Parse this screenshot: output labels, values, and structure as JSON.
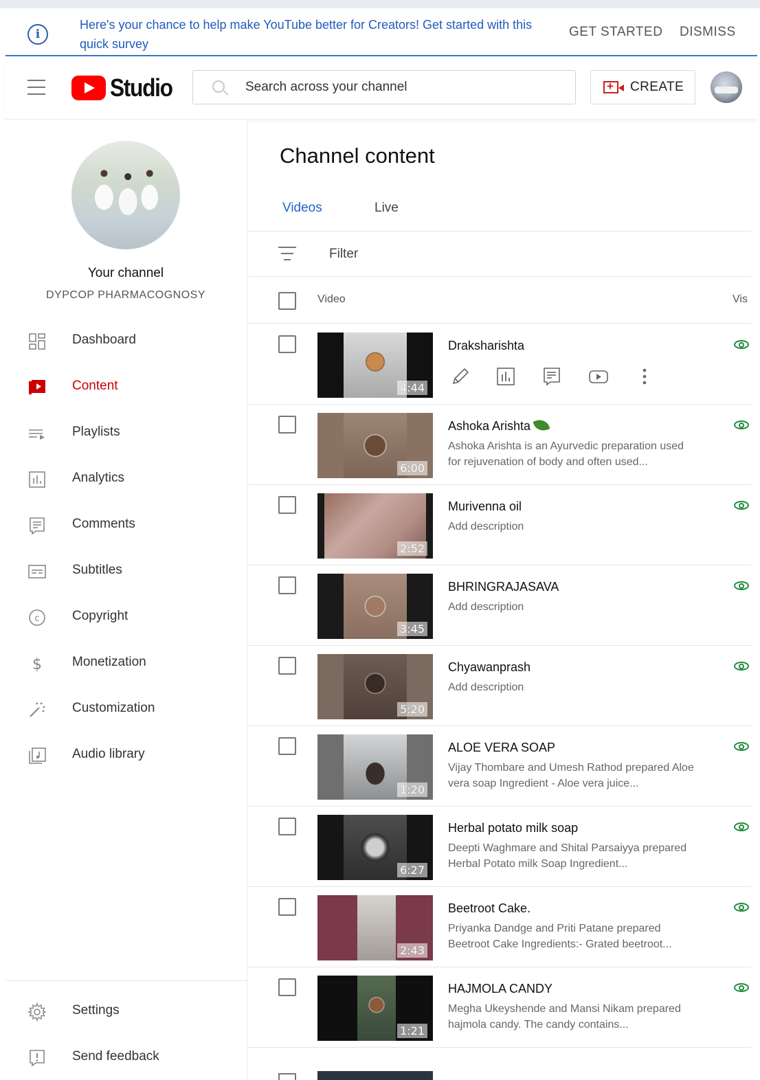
{
  "banner": {
    "message": "Here's your chance to help make YouTube better for Creators! Get started with this quick survey",
    "get_started": "GET STARTED",
    "dismiss": "DISMISS"
  },
  "header": {
    "logo_text": "Studio",
    "search_placeholder": "Search across your channel",
    "create_label": "CREATE"
  },
  "sidebar": {
    "channel_title": "Your channel",
    "channel_name": "DYPCOP PHARMACOGNOSY",
    "items": [
      {
        "label": "Dashboard",
        "icon": "dashboard-icon"
      },
      {
        "label": "Content",
        "icon": "content-icon",
        "active": true
      },
      {
        "label": "Playlists",
        "icon": "playlists-icon"
      },
      {
        "label": "Analytics",
        "icon": "analytics-icon"
      },
      {
        "label": "Comments",
        "icon": "comments-icon"
      },
      {
        "label": "Subtitles",
        "icon": "subtitles-icon"
      },
      {
        "label": "Copyright",
        "icon": "copyright-icon"
      },
      {
        "label": "Monetization",
        "icon": "monetization-icon"
      },
      {
        "label": "Customization",
        "icon": "customization-icon"
      },
      {
        "label": "Audio library",
        "icon": "audio-library-icon"
      }
    ],
    "footer": [
      {
        "label": "Settings",
        "icon": "gear-icon"
      },
      {
        "label": "Send feedback",
        "icon": "feedback-icon"
      }
    ]
  },
  "main": {
    "title": "Channel content",
    "tabs": [
      {
        "label": "Videos",
        "active": true
      },
      {
        "label": "Live"
      }
    ],
    "filter_label": "Filter",
    "columns": {
      "video": "Video",
      "visibility": "Vis"
    },
    "videos": [
      {
        "title": "Draksharishta",
        "description": "",
        "duration": "4:44",
        "show_actions": true
      },
      {
        "title": "Ashoka Arishta",
        "description": "Ashoka Arishta is an Ayurvedic preparation used for rejuvenation of body and often used...",
        "duration": "6:00"
      },
      {
        "title": "Murivenna oil",
        "description": "Add description",
        "duration": "2:52"
      },
      {
        "title": "BHRINGRAJASAVA",
        "description": "Add description",
        "duration": "3:45"
      },
      {
        "title": "Chyawanprash",
        "description": "Add description",
        "duration": "5:20"
      },
      {
        "title": "ALOE VERA SOAP",
        "description": "Vijay Thombare and Umesh Rathod prepared Aloe vera soap Ingredient - Aloe vera juice...",
        "duration": "1:20"
      },
      {
        "title": "Herbal potato milk soap",
        "description": "Deepti Waghmare and Shital Parsaiyya prepared Herbal Potato milk Soap Ingredient...",
        "duration": "6:27"
      },
      {
        "title": "Beetroot Cake.",
        "description": "Priyanka Dandge and Priti Patane prepared Beetroot Cake Ingredients:- Grated beetroot...",
        "duration": "2:43"
      },
      {
        "title": "HAJMOLA CANDY",
        "description": "Megha Ukeyshende and Mansi Nikam prepared hajmola candy. The candy contains...",
        "duration": "1:21"
      }
    ],
    "row_actions": [
      "edit-pencil-icon",
      "analytics-icon",
      "comments-icon",
      "youtube-play-icon",
      "more-vert-icon"
    ],
    "visibility_icon": "eye-icon",
    "colors": {
      "accent_red": "#cc0000",
      "link_blue": "#1f63c9",
      "public_green": "#1e8e3e"
    }
  }
}
